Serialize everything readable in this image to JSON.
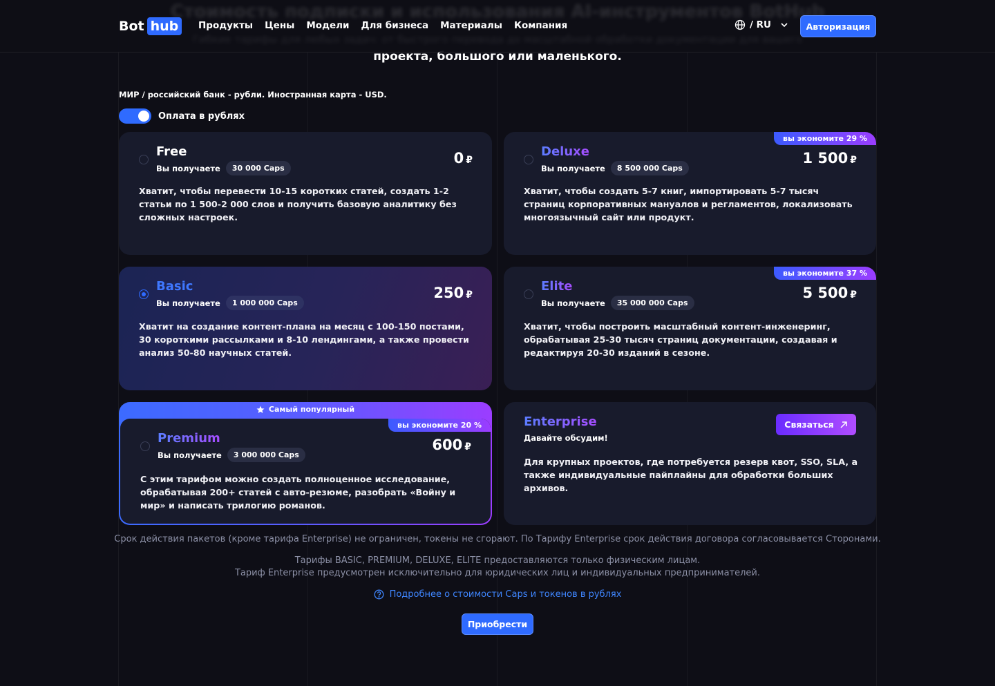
{
  "header": {
    "ghost_title": "Стоимость подписки и использования AI-инструментов BotHub",
    "ghost_subtitle": "Гибкие тарифы для любых задач: от быстрого перевода до масштабной обработки документации для вашего",
    "logo": {
      "part1": "Bot",
      "part2": "hub"
    },
    "nav": [
      "Продукты",
      "Цены",
      "Модели",
      "Для бизнеса",
      "Материалы",
      "Компания"
    ],
    "language": "/ RU",
    "auth_label": "Авторизация"
  },
  "section": {
    "subtitle": "проекта, большого или маленького.",
    "payment_note": "МИР / российский банк - рубли. Иностранная карта - USD.",
    "toggle_label": "Оплата в рублях",
    "toggle_on": true
  },
  "plans": {
    "free": {
      "name": "Free",
      "get_label": "Вы получаете",
      "caps": "30 000 Caps",
      "price": "0",
      "currency": "₽",
      "description": "Хватит, чтобы перевести 10-15 коротких статей, создать 1-2 статьи по 1 500-2 000 слов и получить базовую аналитику без сложных настроек."
    },
    "deluxe": {
      "name": "Deluxe",
      "get_label": "Вы получаете",
      "caps": "8 500 000 Caps",
      "price": "1 500",
      "currency": "₽",
      "save_badge": "вы экономите 29 %",
      "description": "Хватит, чтобы создать 5-7 книг, импортировать 5-7 тысяч страниц корпоративных мануалов и регламентов, локализовать многоязычный сайт или продукт."
    },
    "basic": {
      "name": "Basic",
      "get_label": "Вы получаете",
      "caps": "1 000 000 Caps",
      "price": "250",
      "currency": "₽",
      "description": "Хватит на создание контент-плана на месяц с 100-150 постами, 30 короткими рассылками и 8-10 лендингами, а также провести анализ 50-80 научных статей."
    },
    "elite": {
      "name": "Elite",
      "get_label": "Вы получаете",
      "caps": "35 000 000 Caps",
      "price": "5 500",
      "currency": "₽",
      "save_badge": "вы экономите 37 %",
      "description": "Хватит, чтобы построить масштабный контент-инженеринг, обрабатывая 25-30 тысяч страниц документации, создавая и редактируя 20-30 изданий в сезоне."
    },
    "premium": {
      "popular_label": "Самый популярный",
      "name": "Premium",
      "get_label": "Вы получаете",
      "caps": "3 000 000 Caps",
      "price": "600",
      "currency": "₽",
      "save_badge": "вы экономите 20 %",
      "description": "С этим тарифом можно создать полноценное исследование, обрабатывая 200+ статей с авто-резюме, разобрать «Войну и мир» и написать трилогию романов."
    },
    "enterprise": {
      "name": "Enterprise",
      "tagline": "Давайте обсудим!",
      "contact_label": "Связаться",
      "description": "Для крупных проектов, где потребуется резерв квот, SSO, SLA, а также индивидуальные пайплайны для обработки больших архивов."
    }
  },
  "selected_plan": "Basic",
  "footer": {
    "validity": "Срок действия пакетов (кроме тарифа Enterprise) не ограничен, токены не сгорают. По Тарифу Enterprise срок действия договора согласовывается Сторонами.",
    "individuals": "Тарифы BASIC, PREMIUM, DELUXE, ELITE предоставляются только физическим лицам.",
    "legal": "Тариф Enterprise предусмотрен исключительно для юридических лиц и индивидуальных предпринимателей.",
    "more_link": "Подробнее о стоимости Caps и токенов в рублях",
    "buy_label": "Приобрести"
  },
  "colors": {
    "accent": "#2f6bff",
    "card_bg": "#181b2c",
    "page_bg": "#0e0e16",
    "purple": "#9b3dff"
  }
}
